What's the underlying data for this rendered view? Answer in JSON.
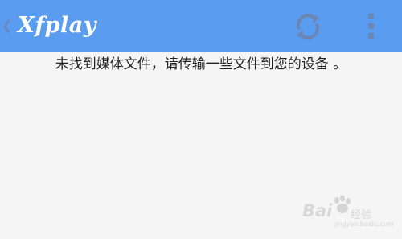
{
  "app": {
    "title": "Xfplay"
  },
  "toolbar": {
    "back_icon": "chevron-left-icon",
    "refresh_icon": "refresh-icon",
    "menu_icon": "more-vertical-icon"
  },
  "content": {
    "empty_message": "未找到媒体文件，请传输一些文件到您的设备 。"
  },
  "watermark": {
    "brand": "Bai",
    "brand_suffix": "经验",
    "url": "jingyan.baidu.com"
  },
  "colors": {
    "header_background": "#5a9cf0",
    "page_background": "#f5f5f5",
    "icon_color": "#6c86b4"
  }
}
